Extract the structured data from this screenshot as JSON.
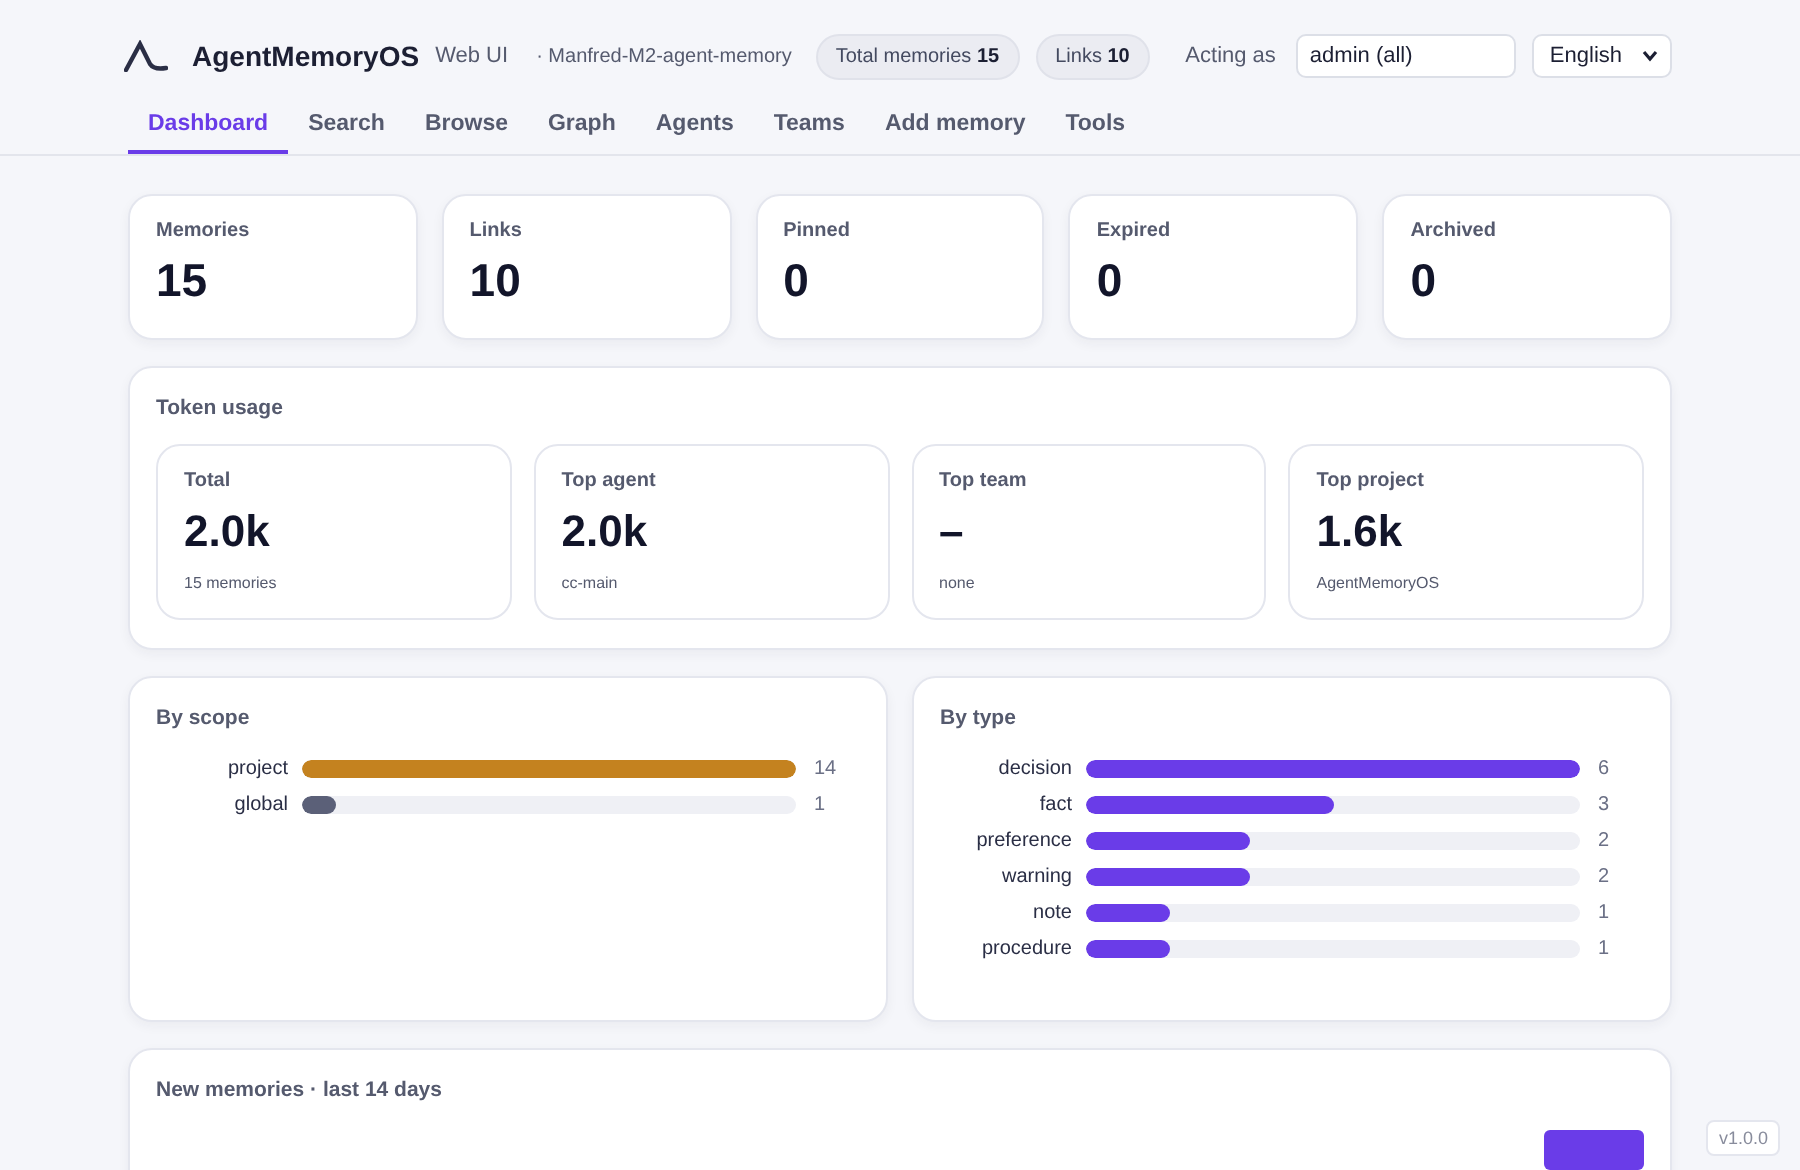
{
  "header": {
    "brand": "AgentMemoryOS",
    "subtitle": "Web UI",
    "project": "· Manfred-M2-agent-memory",
    "pills": [
      {
        "label": "Total memories",
        "value": "15"
      },
      {
        "label": "Links",
        "value": "10"
      }
    ],
    "acting_as_label": "Acting as",
    "acting_as_value": "admin (all)",
    "language": "English"
  },
  "tabs": [
    {
      "label": "Dashboard",
      "selected": true
    },
    {
      "label": "Search",
      "selected": false
    },
    {
      "label": "Browse",
      "selected": false
    },
    {
      "label": "Graph",
      "selected": false
    },
    {
      "label": "Agents",
      "selected": false
    },
    {
      "label": "Teams",
      "selected": false
    },
    {
      "label": "Add memory",
      "selected": false
    },
    {
      "label": "Tools",
      "selected": false
    }
  ],
  "stats": [
    {
      "label": "Memories",
      "value": "15"
    },
    {
      "label": "Links",
      "value": "10"
    },
    {
      "label": "Pinned",
      "value": "0"
    },
    {
      "label": "Expired",
      "value": "0"
    },
    {
      "label": "Archived",
      "value": "0"
    }
  ],
  "token_usage": {
    "title": "Token usage",
    "cards": [
      {
        "label": "Total",
        "value": "2.0k",
        "note": "15 memories"
      },
      {
        "label": "Top agent",
        "value": "2.0k",
        "note": "cc-main"
      },
      {
        "label": "Top team",
        "value": "–",
        "note": "none"
      },
      {
        "label": "Top project",
        "value": "1.6k",
        "note": "AgentMemoryOS"
      }
    ]
  },
  "by_scope": {
    "title": "By scope",
    "rows": [
      {
        "label": "project",
        "count": "14",
        "level": 1,
        "color": "#c4821f"
      },
      {
        "label": "global",
        "count": "1",
        "level": 0.07,
        "color": "#5b6078"
      }
    ]
  },
  "by_type": {
    "title": "By type",
    "rows": [
      {
        "label": "decision",
        "count": "6",
        "level": 1
      },
      {
        "label": "fact",
        "count": "3",
        "level": 0.5
      },
      {
        "label": "preference",
        "count": "2",
        "level": 0.33
      },
      {
        "label": "warning",
        "count": "2",
        "level": 0.33
      },
      {
        "label": "note",
        "count": "1",
        "level": 0.17
      },
      {
        "label": "procedure",
        "count": "1",
        "level": 0.17
      }
    ]
  },
  "new_memories": {
    "title": "New memories · last 14 days"
  },
  "version": "v1.0.0"
}
